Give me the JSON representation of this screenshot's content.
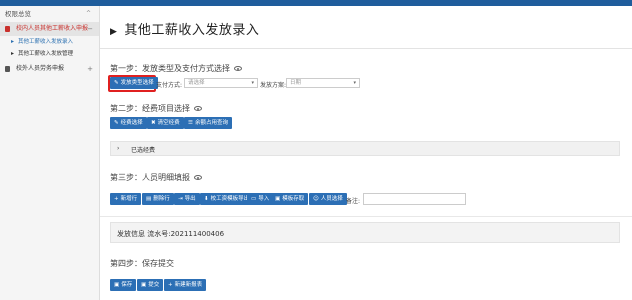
{
  "sidebar": {
    "title": "权限总览",
    "title_chevron": "^",
    "groups": [
      {
        "label": "校内人员其他工薪收入申报",
        "toggle": "−",
        "items": [
          {
            "label": "其他工薪收入发放录入"
          },
          {
            "label": "其他工薪收入发放管理"
          }
        ]
      },
      {
        "label": "校外人员劳务申报",
        "toggle": "+"
      }
    ]
  },
  "page": {
    "title": "其他工薪收入发放录入"
  },
  "step1": {
    "title": "第一步：发放类型及支付方式选择",
    "type_button": "发放类型选择",
    "pay_method_label": "支付方式:",
    "pay_method_placeholder": "请选择",
    "scheme_label": "发放方案:",
    "scheme_value": "日期"
  },
  "step2": {
    "title": "第二步：经费项目选择",
    "buttons": [
      "经费选择",
      "清空经费",
      "余额占用查询"
    ],
    "selected_label": "已选经费"
  },
  "step3": {
    "title": "第三步：人员明细填报",
    "buttons": [
      "新增行",
      "删除行",
      "导出",
      "校工资模板导出",
      "导入",
      "模板存取",
      "人员选择"
    ],
    "remark_label": "备注:"
  },
  "info": {
    "serial": "发放信息 流水号:202111400406"
  },
  "step4": {
    "title": "第四步：保存提交",
    "buttons": [
      "保存",
      "提交",
      "新建新报表"
    ]
  },
  "colors": {
    "accent": "#2c6fb5",
    "active_red": "#c9302c",
    "highlight": "#e02020"
  },
  "icons": {
    "edit": "pencil-icon",
    "clear": "trash-icon",
    "list": "list-icon",
    "plus": "plus-icon",
    "eye": "eye-icon",
    "save": "floppy-icon"
  }
}
